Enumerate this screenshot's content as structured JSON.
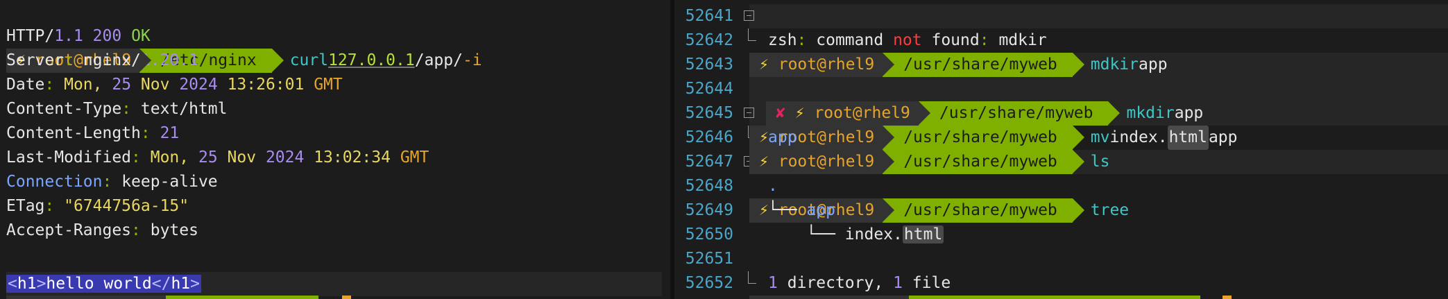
{
  "left_pane": {
    "prompt": {
      "bolt": "⚡",
      "host": "root@rhel9",
      "dir": "/etc/nginx",
      "cmd": "curl",
      "url": "127.0.0.1",
      "path": "/app/",
      "flag": "-i"
    },
    "headers": {
      "status_proto": "HTTP/",
      "status_ver": "1.1",
      "status_code": "200",
      "status_text": "OK",
      "server_key": "Server",
      "server_val1": "nginx/",
      "server_val2": "1.20.1",
      "date_key": "Date",
      "date_day": "Mon,",
      "date_num": "25",
      "date_month": "Nov",
      "date_year": "2024",
      "date_time": "13:26:01",
      "date_tz": "GMT",
      "ctype_key": "Content-Type",
      "ctype_val": "text/html",
      "clen_key": "Content-Length",
      "clen_val": "21",
      "lmod_key": "Last-Modified",
      "lmod_day": "Mon,",
      "lmod_num": "25",
      "lmod_month": "Nov",
      "lmod_year": "2024",
      "lmod_time": "13:02:34",
      "lmod_tz": "GMT",
      "conn_key": "Connection",
      "conn_val": "keep-alive",
      "etag_key": "ETag",
      "etag_val": "\"6744756a-15\"",
      "ar_key": "Accept-Ranges",
      "ar_val": "bytes"
    },
    "body": {
      "open_lt": "<",
      "open_tag": "h1",
      "open_gt": ">",
      "text": "hello world",
      "close_lt": "</",
      "close_tag": "h1",
      "close_gt": ">"
    }
  },
  "right_pane": {
    "line_numbers": [
      "52641",
      "52642",
      "52643",
      "52644",
      "52645",
      "52646",
      "52647",
      "52648",
      "52649",
      "52650",
      "52651",
      "52652"
    ],
    "host": "root@rhel9",
    "dir": "/usr/share/myweb",
    "bolt": "⚡",
    "xmark": "✘",
    "cmd1": "mdkir",
    "cmd1_arg": "app",
    "err_shell": "zsh",
    "err_colon1": ":",
    "err_text1": "command",
    "err_not": "not",
    "err_text2": "found",
    "err_colon2": ":",
    "err_cmd": "mdkir",
    "cmd2": "mkdir",
    "cmd2_arg": "app",
    "cmd3": "mv",
    "cmd3_arg1_a": "index.",
    "cmd3_arg1_b": "html",
    "cmd3_arg2": "app",
    "cmd4": "ls",
    "ls_out": "app",
    "cmd5": "tree",
    "tree_dot": ".",
    "tree_branch1": "└──",
    "tree_dir": "app",
    "tree_branch2": "└──",
    "tree_file_a": "index.",
    "tree_file_b": "html",
    "summary_n1": "1",
    "summary_t1": "directory,",
    "summary_n2": "1",
    "summary_t2": "file"
  }
}
